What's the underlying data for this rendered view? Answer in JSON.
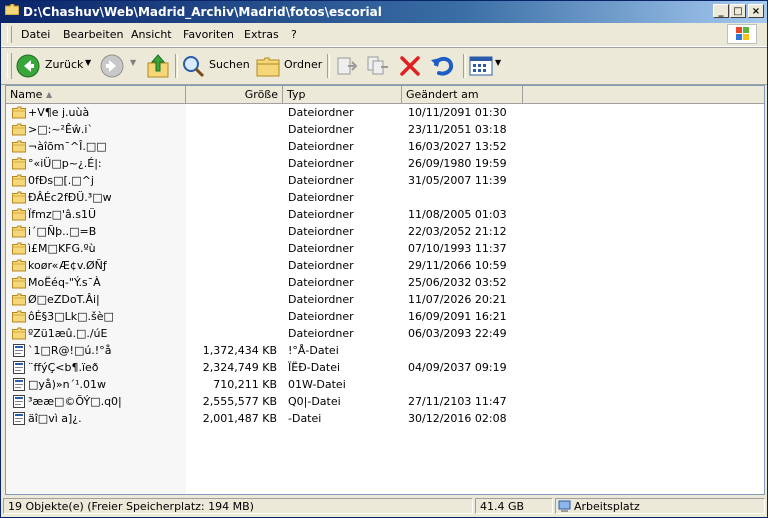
{
  "titlebar": {
    "path": "D:\\Chashuv\\Web\\Madrid_Archiv\\Madrid\\fotos\\escorial",
    "buttons": {
      "minimize": "_",
      "maximize": "□",
      "close": "×"
    }
  },
  "menu": [
    "Datei",
    "Bearbeiten",
    "Ansicht",
    "Favoriten",
    "Extras",
    "?"
  ],
  "toolbar": {
    "back_label": "Zurück",
    "search_label": "Suchen",
    "folders_label": "Ordner",
    "icons": [
      "back-icon",
      "forward-icon",
      "up-folder-icon",
      "search-icon",
      "folders-icon",
      "move-to-icon",
      "copy-to-icon",
      "delete-icon",
      "undo-icon",
      "views-icon"
    ]
  },
  "columns": {
    "name": "Name",
    "size": "Größe",
    "type": "Typ",
    "modified": "Geändert am"
  },
  "rows": [
    {
      "name": "+V¶e j.uùà",
      "size": "",
      "type": "Dateiordner",
      "date": "10/11/2091 01:30",
      "kind": "folder"
    },
    {
      "name": ">□:~²Êŵ.i`",
      "size": "",
      "type": "Dateiordner",
      "date": "23/11/2051 03:18",
      "kind": "folder"
    },
    {
      "name": "¬àîõm¯^Î.□□",
      "size": "",
      "type": "Dateiordner",
      "date": "16/03/2027 13:52",
      "kind": "folder"
    },
    {
      "name": "°«iÜ□p~¿.É|:",
      "size": "",
      "type": "Dateiordner",
      "date": "26/09/1980 19:59",
      "kind": "folder"
    },
    {
      "name": "0fÐs□[.□^j",
      "size": "",
      "type": "Dateiordner",
      "date": "31/05/2007 11:39",
      "kind": "folder"
    },
    {
      "name": "ÐÂÉc2fÐÜ.³□w",
      "size": "",
      "type": "Dateiordner",
      "date": "",
      "kind": "folder"
    },
    {
      "name": "Ïfmz□'â.s1Ü",
      "size": "",
      "type": "Dateiordner",
      "date": "11/08/2005 01:03",
      "kind": "folder"
    },
    {
      "name": "i´□Ñþ..□=B",
      "size": "",
      "type": "Dateiordner",
      "date": "22/03/2052 21:12",
      "kind": "folder"
    },
    {
      "name": "ì£M□KFG.ºù",
      "size": "",
      "type": "Dateiordner",
      "date": "07/10/1993 11:37",
      "kind": "folder"
    },
    {
      "name": "koør«Æ¢v.ØÑƒ",
      "size": "",
      "type": "Dateiordner",
      "date": "29/11/2066 10:59",
      "kind": "folder"
    },
    {
      "name": "MoËéq-\"Ý.s¯À",
      "size": "",
      "type": "Dateiordner",
      "date": "25/06/2032 03:52",
      "kind": "folder"
    },
    {
      "name": "Ø□eZDoT.Âi|",
      "size": "",
      "type": "Dateiordner",
      "date": "11/07/2026 20:21",
      "kind": "folder"
    },
    {
      "name": "ôÉ§3□Lk□.šè□",
      "size": "",
      "type": "Dateiordner",
      "date": "16/09/2091 16:21",
      "kind": "folder"
    },
    {
      "name": "ºZü1æû.□./úE",
      "size": "",
      "type": "Dateiordner",
      "date": "06/03/2093 22:49",
      "kind": "folder"
    },
    {
      "name": "`1□R@!□ú.!°å",
      "size": "1,372,434 KB",
      "type": "!°Å-Datei",
      "date": "",
      "kind": "file"
    },
    {
      "name": "¨ffýÇ<b¶.ïeð",
      "size": "2,324,749 KB",
      "type": "ÏËÐ-Datei",
      "date": "04/09/2037 09:19",
      "kind": "file"
    },
    {
      "name": "□yå)»n´¹.01w",
      "size": "710,211 KB",
      "type": "01W-Datei",
      "date": "",
      "kind": "file"
    },
    {
      "name": "³ææ□©ÕÝ□.q0|",
      "size": "2,555,577 KB",
      "type": "Q0|-Datei",
      "date": "27/11/2103 11:47",
      "kind": "file"
    },
    {
      "name": "äî□vì a]¿.",
      "size": "2,001,487 KB",
      "type": "-Datei",
      "date": "30/12/2016 02:08",
      "kind": "file"
    }
  ],
  "status": {
    "objects": "19 Objekte(e) (Freier Speicherplatz: 194 MB)",
    "size": "41.4 GB",
    "location": "Arbeitsplatz"
  }
}
